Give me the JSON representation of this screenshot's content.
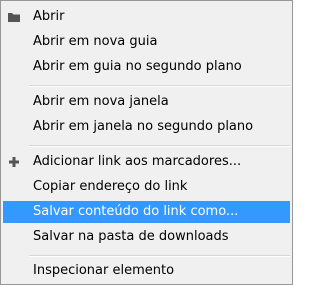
{
  "menu": {
    "items": [
      {
        "label": "Abrir",
        "icon": "folder-icon"
      },
      {
        "label": "Abrir em nova guia"
      },
      {
        "label": "Abrir em guia no segundo plano"
      },
      {
        "label": "Abrir em nova janela"
      },
      {
        "label": "Abrir em janela no segundo plano"
      },
      {
        "label": "Adicionar link aos marcadores...",
        "icon": "plus-icon"
      },
      {
        "label": "Copiar endereço do link"
      },
      {
        "label": "Salvar conteúdo do link como...",
        "highlighted": true
      },
      {
        "label": "Salvar na pasta de downloads"
      },
      {
        "label": "Inspecionar elemento"
      }
    ]
  },
  "colors": {
    "menu_background": "#f0f0f0",
    "highlight": "#3399ff",
    "highlight_text": "#ffffff",
    "border": "#979797",
    "separator": "#d7d7d7"
  }
}
